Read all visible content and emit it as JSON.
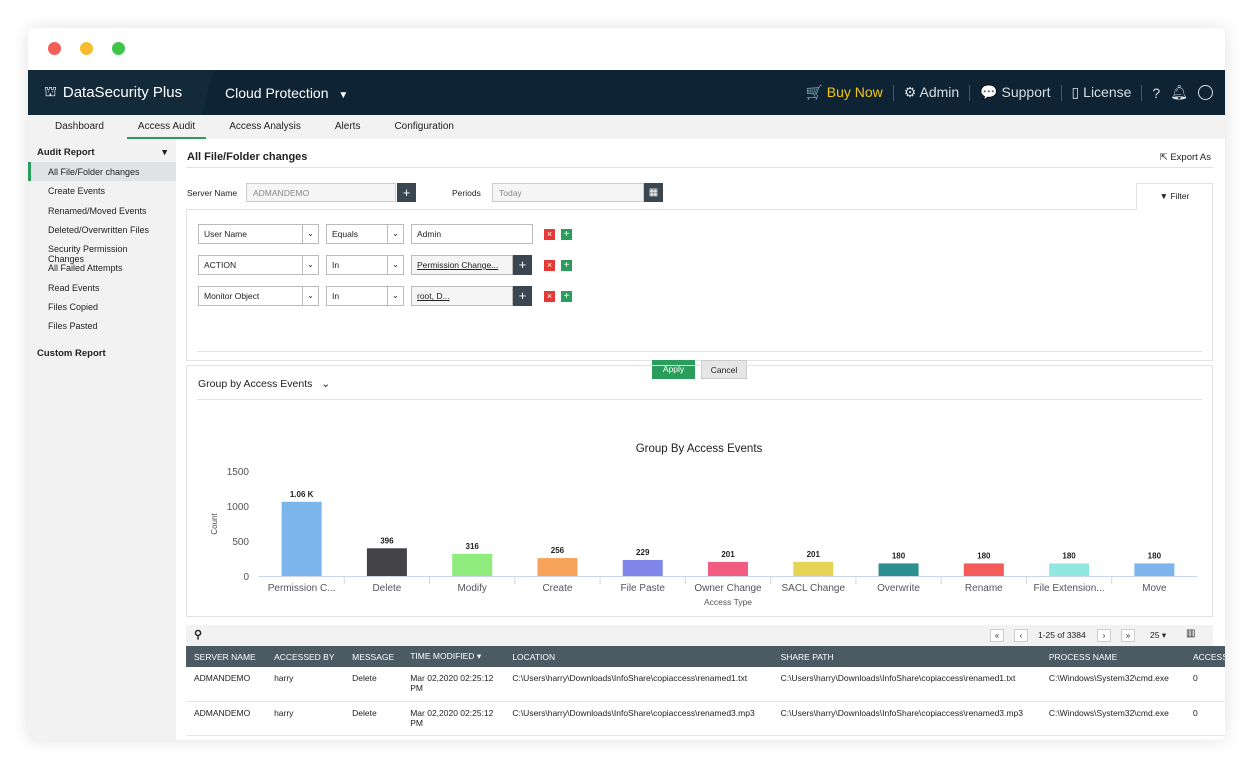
{
  "window": {
    "traffic_colors": [
      "#f25f57",
      "#f8bd2f",
      "#3fc54a"
    ]
  },
  "header": {
    "brand": "DataSecurity Plus",
    "product": "Cloud Protection",
    "buy_now": "Buy Now",
    "admin": "Admin",
    "support": "Support",
    "license": "License",
    "help": "?"
  },
  "nav": {
    "tabs": [
      "Dashboard",
      "Access Audit",
      "Access Analysis",
      "Alerts",
      "Configuration"
    ],
    "active": "Access Audit"
  },
  "sidebar": {
    "audit_report": "Audit Report",
    "items": [
      "All File/Folder changes",
      "Create Events",
      "Renamed/Moved Events",
      "Deleted/Overwritten Files",
      "Security Permission Changes",
      "All Failed Attempts",
      "Read Events",
      "Files Copied",
      "Files Pasted"
    ],
    "custom_report": "Custom Report"
  },
  "main": {
    "title": "All File/Folder changes",
    "export": "Export As",
    "server_label": "Server Name",
    "server_value": "ADMANDEMO",
    "periods_label": "Periods",
    "periods_value": "Today",
    "filter": "Filter",
    "filters": [
      {
        "field": "User Name",
        "op": "Equals",
        "value": "Admin"
      },
      {
        "field": "ACTION",
        "op": "In",
        "value": "Permission Change..."
      },
      {
        "field": "Monitor Object",
        "op": "In",
        "value": "root, D..."
      }
    ],
    "apply": "Apply",
    "cancel": "Cancel",
    "group_by": "Group by Access Events"
  },
  "chart_data": {
    "type": "bar",
    "title": "Group By Access Events",
    "xlabel": "Access Type",
    "ylabel": "Count",
    "ylim": [
      0,
      1500
    ],
    "yticks": [
      "0",
      "500",
      "1000",
      "1500"
    ],
    "categories": [
      "Permission C...",
      "Delete",
      "Modify",
      "Create",
      "File Paste",
      "Owner Change",
      "SACL Change",
      "Overwrite",
      "Rename",
      "File Extension...",
      "Move"
    ],
    "values": [
      1060,
      396,
      316,
      256,
      229,
      201,
      201,
      180,
      180,
      180,
      180
    ],
    "labels": [
      "1.06 K",
      "396",
      "316",
      "256",
      "229",
      "201",
      "201",
      "180",
      "180",
      "180",
      "180"
    ],
    "colors": [
      "#7cb5ec",
      "#434348",
      "#90ed7d",
      "#f7a35c",
      "#8085e9",
      "#f15c80",
      "#e4d354",
      "#2b908f",
      "#f45b5b",
      "#91e8e1",
      "#7cb5ec"
    ],
    "grid": false
  },
  "pagination": {
    "range": "1-25 of 3384",
    "per_page": "25"
  },
  "table": {
    "columns": [
      "SERVER NAME",
      "ACCESSED BY",
      "MESSAGE",
      "TIME MODIFIED",
      "LOCATION",
      "SHARE PATH",
      "PROCESS NAME",
      "ACCESS"
    ],
    "rows": [
      [
        "ADMANDEMO",
        "harry",
        "Delete",
        "Mar 02,2020 02:25:12 PM",
        "C:\\Users\\harry\\Downloads\\InfoShare\\copiaccess\\renamed1.txt",
        "C:\\Users\\harry\\Downloads\\InfoShare\\copiaccess\\renamed1.txt",
        "C:\\Windows\\System32\\cmd.exe",
        "0"
      ],
      [
        "ADMANDEMO",
        "harry",
        "Delete",
        "Mar 02,2020 02:25:12 PM",
        "C:\\Users\\harry\\Downloads\\InfoShare\\copiaccess\\renamed3.mp3",
        "C:\\Users\\harry\\Downloads\\InfoShare\\copiaccess\\renamed3.mp3",
        "C:\\Windows\\System32\\cmd.exe",
        "0"
      ]
    ]
  }
}
